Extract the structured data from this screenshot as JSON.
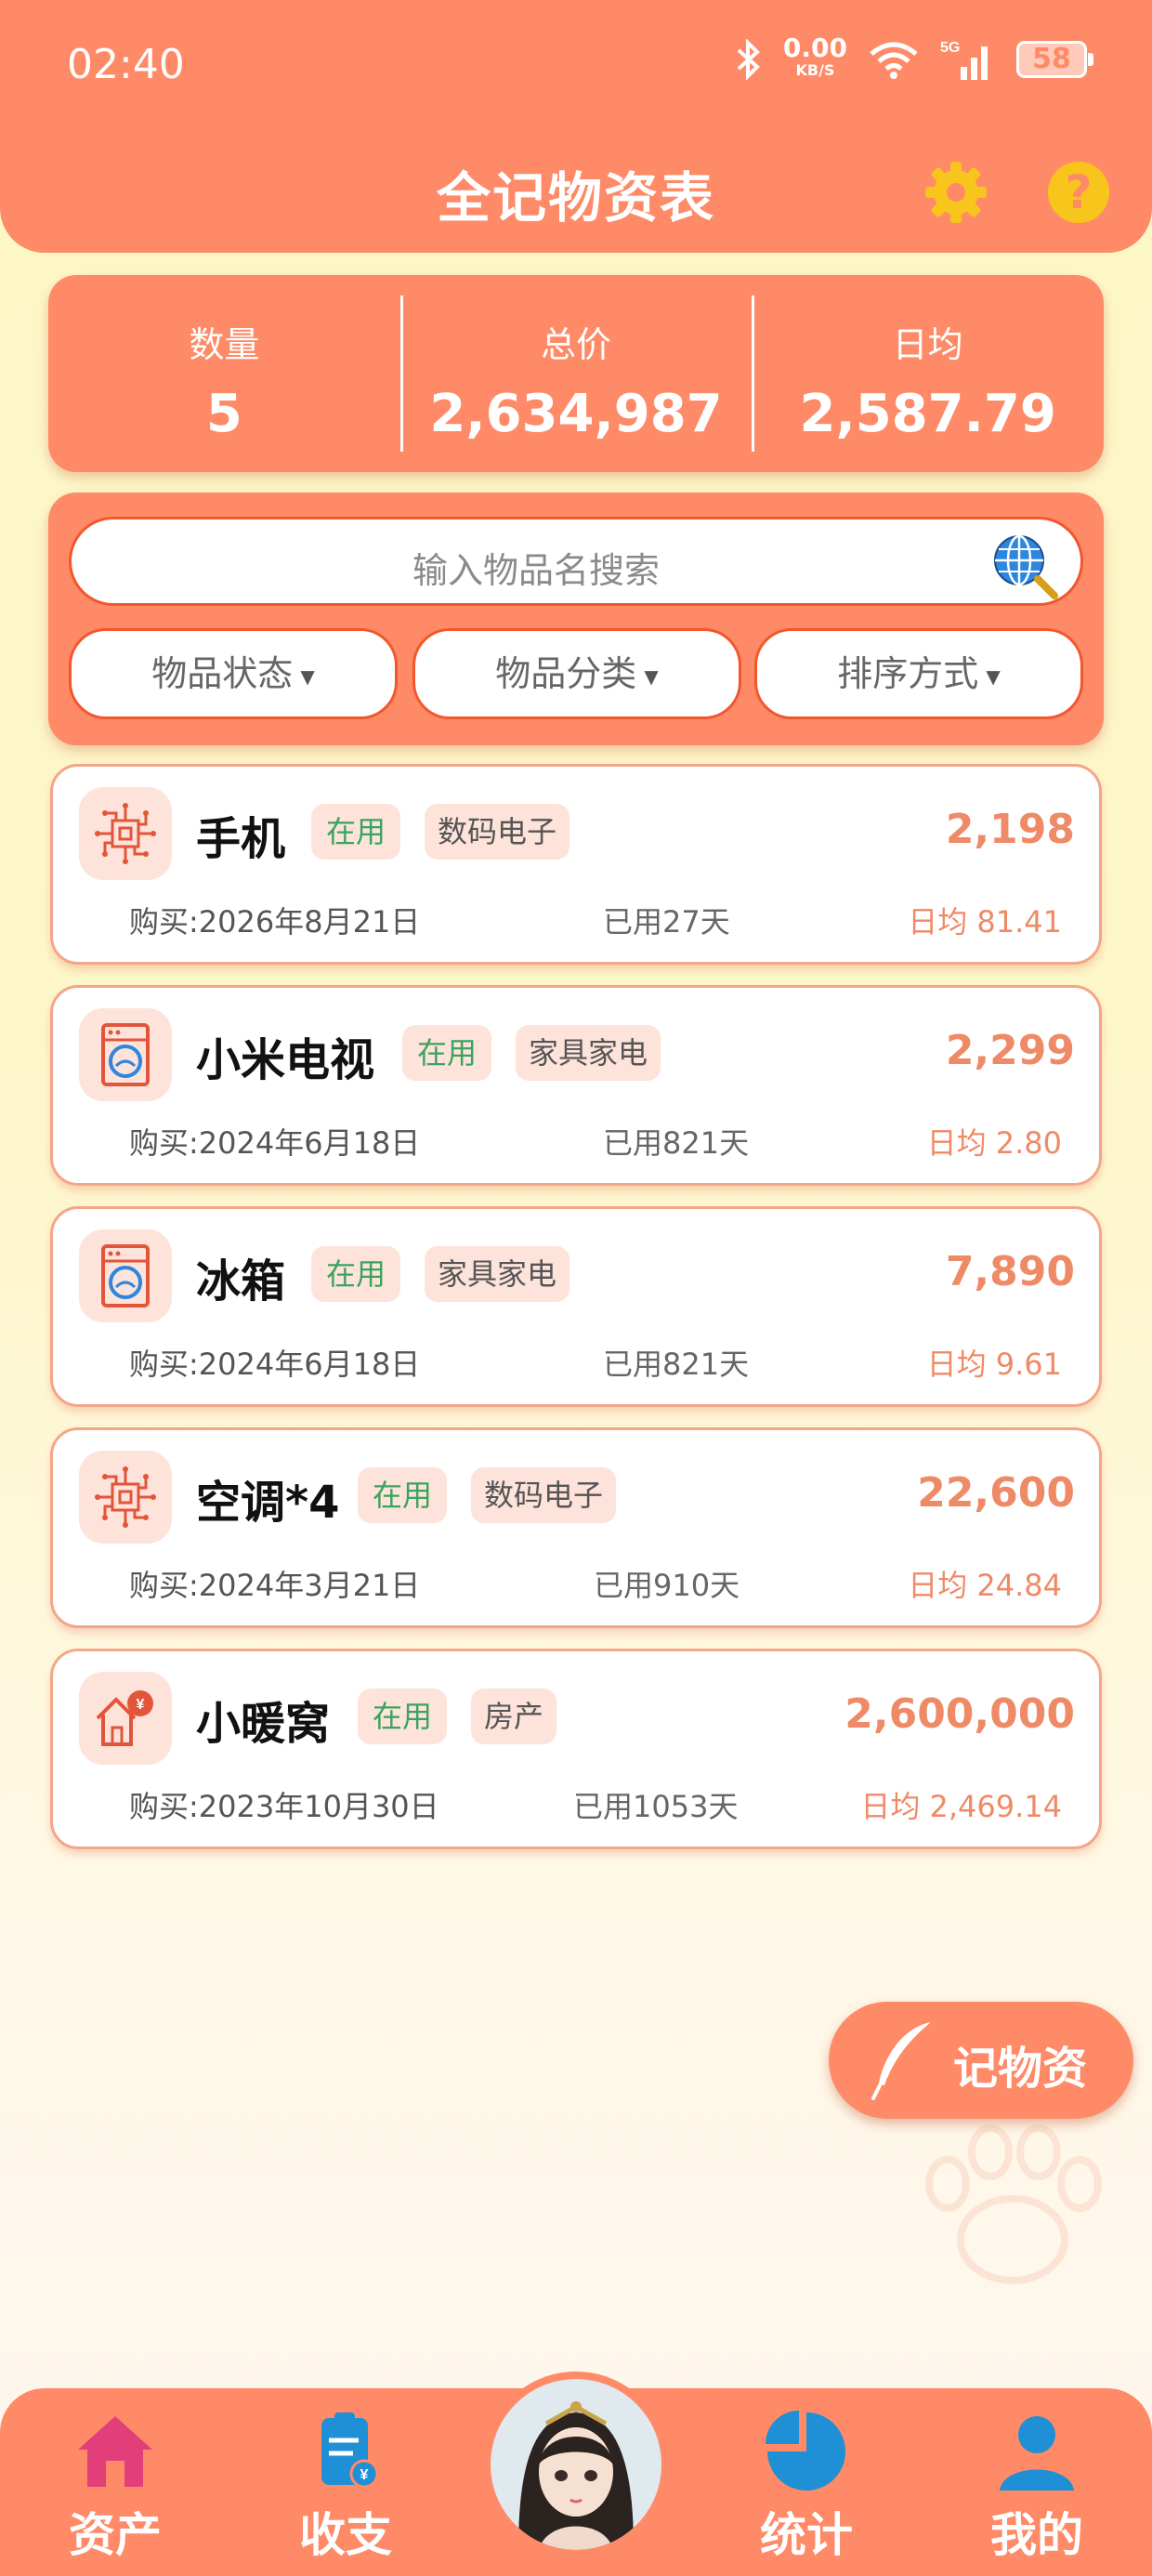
{
  "status_bar": {
    "time": "02:40",
    "net_speed": "0.00",
    "net_unit": "KB/S",
    "signal": "5G",
    "battery": "58"
  },
  "header": {
    "title": "全记物资表",
    "settings_icon": "gear-icon",
    "help_icon": "help-icon",
    "help_glyph": "?"
  },
  "stats": {
    "count_label": "数量",
    "count_value": "5",
    "total_label": "总价",
    "total_value": "2,634,987",
    "daily_label": "日均",
    "daily_value": "2,587.79"
  },
  "search": {
    "placeholder": "输入物品名搜索"
  },
  "filters": {
    "status": "物品状态",
    "category": "物品分类",
    "sort": "排序方式"
  },
  "items": [
    {
      "icon": "circuit-icon",
      "name": "手机",
      "status": "在用",
      "category": "数码电子",
      "price": "2,198",
      "date": "购买:2026年8月21日",
      "used": "已用27天",
      "daily": "日均 81.41"
    },
    {
      "icon": "washer-icon",
      "name": "小米电视",
      "status": "在用",
      "category": "家具家电",
      "price": "2,299",
      "date": "购买:2024年6月18日",
      "used": "已用821天",
      "daily": "日均 2.80"
    },
    {
      "icon": "washer-icon",
      "name": "冰箱",
      "status": "在用",
      "category": "家具家电",
      "price": "7,890",
      "date": "购买:2024年6月18日",
      "used": "已用821天",
      "daily": "日均 9.61"
    },
    {
      "icon": "circuit-icon",
      "name": "空调*4",
      "status": "在用",
      "category": "数码电子",
      "price": "22,600",
      "date": "购买:2024年3月21日",
      "used": "已用910天",
      "daily": "日均 24.84"
    },
    {
      "icon": "house-money-icon",
      "name": "小暖窝",
      "status": "在用",
      "category": "房产",
      "price": "2,600,000",
      "date": "购买:2023年10月30日",
      "used": "已用1053天",
      "daily": "日均 2,469.14"
    }
  ],
  "fab": {
    "label": "记物资",
    "icon": "feather-icon"
  },
  "bottom_nav": {
    "assets": "资产",
    "income_expense": "收支",
    "stats": "统计",
    "mine": "我的"
  },
  "colors": {
    "accent": "#fe8a67",
    "status_green": "#3aa35f",
    "price": "#ef8a67",
    "gear": "#f7c51c"
  }
}
